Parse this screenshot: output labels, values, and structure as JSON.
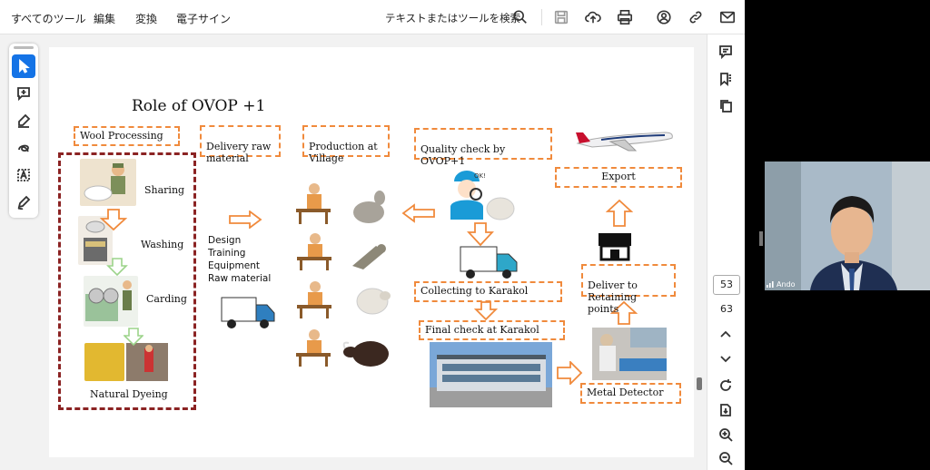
{
  "menu": {
    "all_tools": "すべてのツール",
    "edit": "編集",
    "convert": "変換",
    "esign": "電子サイン"
  },
  "toolbar": {
    "search_text": "テキストまたはツールを検索",
    "icons": [
      "search-icon",
      "save-icon",
      "upload-cloud-icon",
      "print-icon",
      "share-user-icon",
      "link-icon",
      "mail-icon"
    ]
  },
  "left_tools": [
    "select-cursor-icon",
    "add-comment-icon",
    "highlight-pen-icon",
    "draw-loop-icon",
    "text-box-icon",
    "sign-pen-icon"
  ],
  "right_panel": {
    "icons_top": [
      "comment-icon",
      "bookmark-icon",
      "pages-icon"
    ],
    "current_page": "53",
    "total_pages": "63",
    "icons_bottom": [
      "chevron-up-icon",
      "chevron-down-icon",
      "rotate-icon",
      "save-page-icon",
      "zoom-in-icon",
      "zoom-out-icon"
    ]
  },
  "slide": {
    "title": "Role of OVOP +1",
    "wool_processing": "Wool Processing",
    "delivery_raw": "Delivery raw\nmaterial",
    "production": "Production at\nVillage",
    "quality": "Quality check by\nOVOP+1",
    "export": "Export",
    "steps": {
      "sharing": "Sharing",
      "washing": "Washing",
      "carding": "Carding",
      "dyeing": "Natural Dyeing"
    },
    "delivery_list": [
      "Design",
      "Training",
      "Equipment",
      "Raw material"
    ],
    "collecting": "Collecting to Karakol",
    "final_check": "Final check at Karakol",
    "deliver_retaining": "Deliver to\nRetaining points",
    "metal_detector": "Metal Detector"
  },
  "video": {
    "participant_name": "Ando"
  },
  "colors": {
    "orange_dashed": "#f08a3c",
    "maroon_dashed": "#8b2323",
    "accent_blue": "#1473e6"
  }
}
